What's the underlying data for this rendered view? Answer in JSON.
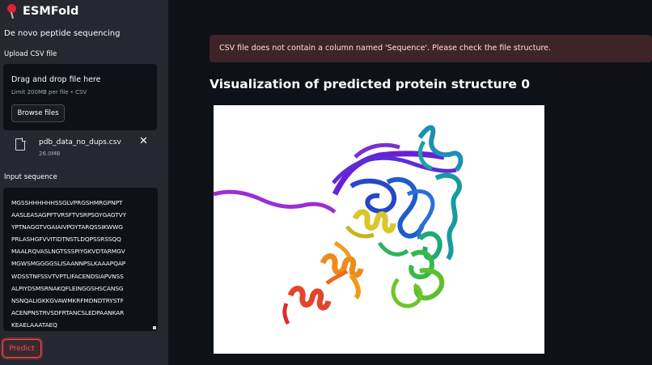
{
  "sidebar": {
    "app_title": "ESMFold",
    "subtitle": "De novo peptide sequencing",
    "upload_label": "Upload CSV file",
    "dropzone": {
      "title": "Drag and drop file here",
      "limit": "Limit 200MB per file • CSV",
      "browse_label": "Browse files"
    },
    "file": {
      "name": "pdb_data_no_dups.csv",
      "size": "26.0MB",
      "close_glyph": "✕"
    },
    "input_label": "Input sequence",
    "sequence": "MGSSHHHHHHSSGLVPRGSHMRGPNPT\nAASLEASAGPFTVRSFTVSRPSGYGAGTVY\nYPTNAGGTVGAIAIVPGYTARQSSIKWWG\nPRLASHGFVVITIDTNSTLDQPSSRSSQQ\nMAALRQVASLNGTSSSPIYGKVDTARMGV\nMGWSMGGGGSLISAANNPSLKAAAPQAP\nWDSSTNFSSVTVPTLIFACENDSIAPVNSS\nALPIYDSMSRNAKQFLEINGGSHSCANSG\nNSNQALIGKKGVAWMKRFMDNDTRYSTF\nACENPNSTRVSDFRTANCSLEDPAANKAR\nKEAELAAATAEQ",
    "predict_label": "Predict"
  },
  "main": {
    "error_message": "CSV file does not contain a column named 'Sequence'. Please check the file structure.",
    "viz_title": "Visualization of predicted protein structure 0"
  },
  "colors": {
    "sidebar_bg": "#262730",
    "main_bg": "#0e1117",
    "error_bg": "#3e2428",
    "accent": "#ff4b4b"
  },
  "icons": [
    "pin-icon",
    "file-icon",
    "close-icon"
  ]
}
